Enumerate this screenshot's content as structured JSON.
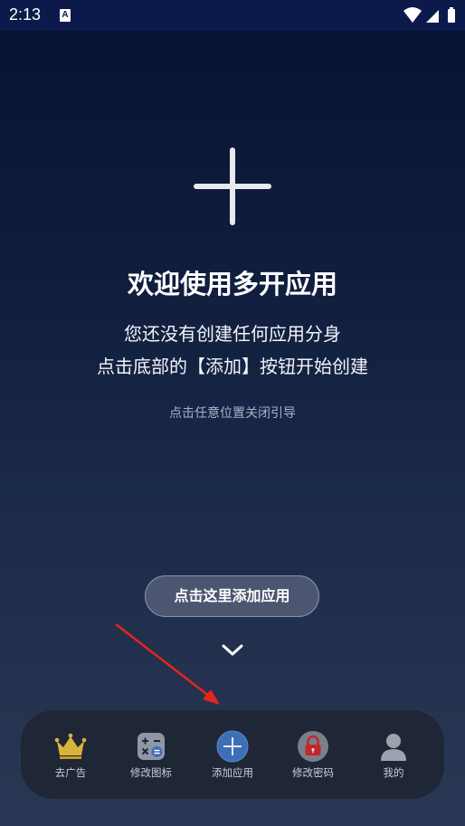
{
  "status_bar": {
    "time": "2:13",
    "app_icon_letter": "A"
  },
  "main": {
    "plus_icon": "plus-icon",
    "title": "欢迎使用多开应用",
    "subtitle_line1": "您还没有创建任何应用分身",
    "subtitle_line2": "点击底部的【添加】按钮开始创建",
    "dismiss_hint": "点击任意位置关闭引导"
  },
  "guide": {
    "button_label": "点击这里添加应用",
    "chevron_icon": "chevron-down-icon",
    "arrow_color": "#e8231d"
  },
  "bottom_nav": {
    "items": [
      {
        "label": "去广告",
        "icon": "crown-icon"
      },
      {
        "label": "修改图标",
        "icon": "calculator-icon"
      },
      {
        "label": "添加应用",
        "icon": "add-circle-icon"
      },
      {
        "label": "修改密码",
        "icon": "lock-icon"
      },
      {
        "label": "我的",
        "icon": "person-icon"
      }
    ]
  },
  "colors": {
    "accent_blue": "#3d6fb8",
    "crown_gold": "#d9b43a",
    "lock_red": "#c0282e"
  }
}
